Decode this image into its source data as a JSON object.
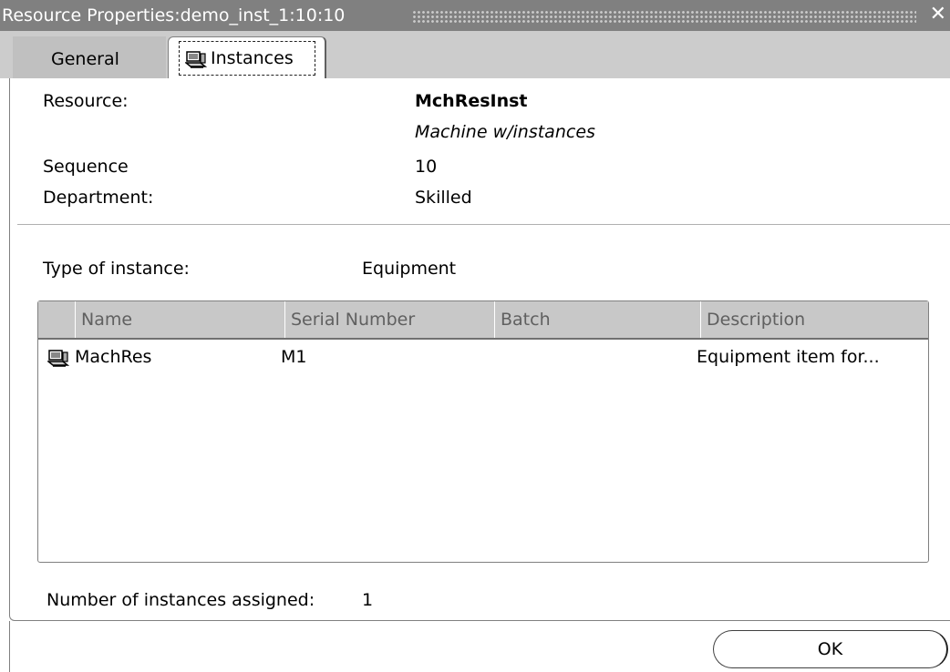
{
  "window": {
    "title": "Resource Properties:demo_inst_1:10:10",
    "close_icon": "close-icon"
  },
  "tabs": [
    {
      "label": "General",
      "active": false
    },
    {
      "label": "Instances",
      "active": true,
      "icon": "machine-icon"
    }
  ],
  "resource": {
    "resource_label": "Resource:",
    "resource_value": "MchResInst",
    "resource_desc": "Machine w/instances",
    "sequence_label": "Sequence",
    "sequence_value": "10",
    "department_label": "Department:",
    "department_value": "Skilled"
  },
  "instance": {
    "type_label": "Type of instance:",
    "type_value": "Equipment"
  },
  "table": {
    "columns": [
      "Name",
      "Serial Number",
      "Batch",
      "Description"
    ],
    "rows": [
      {
        "icon": "machine-icon",
        "name": "MachRes",
        "serial": "M1",
        "batch": "",
        "description": "Equipment item for..."
      }
    ]
  },
  "summary": {
    "count_label": "Number of instances assigned:",
    "count_value": "1"
  },
  "footer": {
    "ok_label": "OK"
  }
}
